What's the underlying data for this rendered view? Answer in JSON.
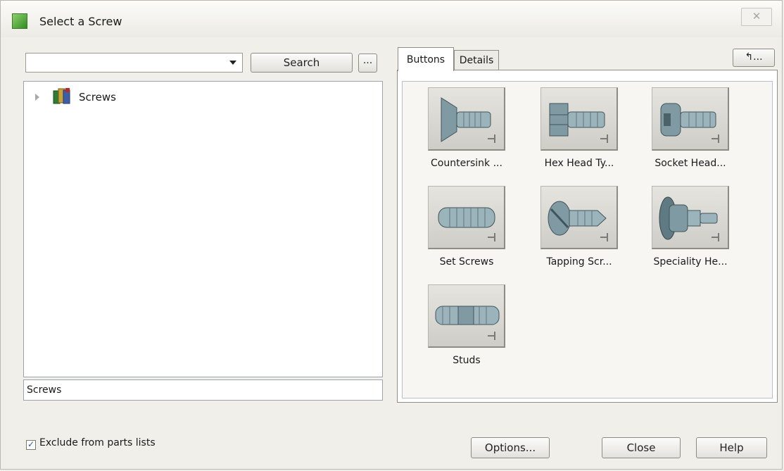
{
  "window": {
    "title": "Select a Screw",
    "close_glyph": "✕"
  },
  "search": {
    "value": "",
    "button_label": "Search",
    "more_label": "..."
  },
  "tree": {
    "items": [
      {
        "label": "Screws",
        "icon": "screws-folder-icon"
      }
    ]
  },
  "status": {
    "text": "Screws"
  },
  "tabs": [
    {
      "label": "Buttons",
      "active": true
    },
    {
      "label": "Details",
      "active": false
    }
  ],
  "up_button": {
    "label": "↰..."
  },
  "items": [
    {
      "label": "Countersink ...",
      "icon": "countersink-screw-icon"
    },
    {
      "label": "Hex Head Ty...",
      "icon": "hex-head-screw-icon"
    },
    {
      "label": "Socket Head...",
      "icon": "socket-head-screw-icon"
    },
    {
      "label": "Set Screws",
      "icon": "set-screw-icon"
    },
    {
      "label": "Tapping Scr...",
      "icon": "tapping-screw-icon"
    },
    {
      "label": "Speciality He...",
      "icon": "speciality-head-screw-icon"
    },
    {
      "label": "Studs",
      "icon": "stud-icon"
    }
  ],
  "footer": {
    "exclude_label": "Exclude from parts lists",
    "exclude_checked": true,
    "check_glyph": "✓",
    "options_label": "Options...",
    "close_label": "Close",
    "help_label": "Help"
  }
}
